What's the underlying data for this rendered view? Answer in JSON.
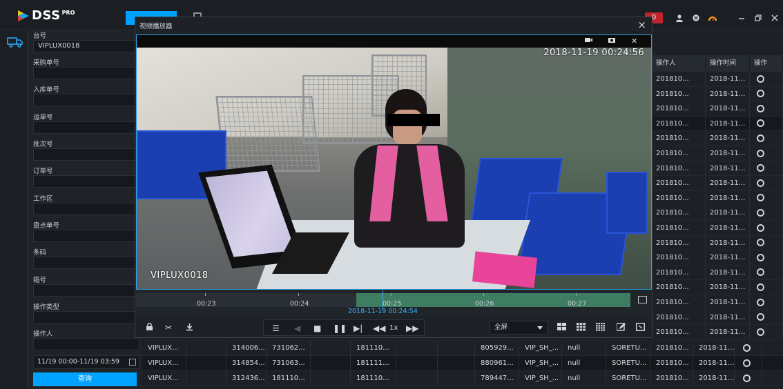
{
  "app": {
    "name": "DSS",
    "edition": "PRO"
  },
  "header": {
    "alarm_count": "0"
  },
  "filter": {
    "fields": [
      {
        "label": "台号",
        "value": "VIPLUX0018"
      },
      {
        "label": "采购单号",
        "value": ""
      },
      {
        "label": "入库单号",
        "value": ""
      },
      {
        "label": "运单号",
        "value": ""
      },
      {
        "label": "批次号",
        "value": ""
      },
      {
        "label": "订单号",
        "value": ""
      },
      {
        "label": "工作区",
        "value": ""
      },
      {
        "label": "盘点单号",
        "value": ""
      },
      {
        "label": "条码",
        "value": ""
      },
      {
        "label": "箱号",
        "value": ""
      },
      {
        "label": "操作类型",
        "value": ""
      },
      {
        "label": "操作人",
        "value": ""
      }
    ],
    "date_range": "11/19 00:00-11/19 03:59",
    "query_label": "查询"
  },
  "modal": {
    "title": "视频播放器",
    "video_timestamp": "2018-11-19 00:24:56",
    "camera_label": "VIPLUX0018"
  },
  "timeline": {
    "labels": [
      "00:23",
      "00:24",
      "00:25",
      "00:26",
      "00:27"
    ],
    "cursor_time": "2018-11-19 00:24:54"
  },
  "controls": {
    "speed": "1x",
    "layout_select": "全屏"
  },
  "right_table": {
    "headers": [
      "操作人",
      "操作时间",
      "操作"
    ],
    "rows": [
      [
        "201810...",
        "2018-11..."
      ],
      [
        "201810...",
        "2018-11..."
      ],
      [
        "201810...",
        "2018-11..."
      ],
      [
        "201810...",
        "2018-11..."
      ],
      [
        "201810...",
        "2018-11..."
      ],
      [
        "201810...",
        "2018-11..."
      ],
      [
        "201810...",
        "2018-11..."
      ],
      [
        "201810...",
        "2018-11..."
      ],
      [
        "201810...",
        "2018-11..."
      ],
      [
        "201810...",
        "2018-11..."
      ],
      [
        "201810...",
        "2018-11..."
      ],
      [
        "201810...",
        "2018-11..."
      ],
      [
        "201810...",
        "2018-11..."
      ],
      [
        "201810...",
        "2018-11..."
      ],
      [
        "201810...",
        "2018-11..."
      ],
      [
        "201810...",
        "2018-11..."
      ],
      [
        "201810...",
        "2018-11..."
      ],
      [
        "201810...",
        "2018-11..."
      ]
    ]
  },
  "bottom_table": {
    "rows": [
      [
        "VIPLUX...",
        "",
        "314006...",
        "731062...",
        "",
        "181110...",
        "",
        "",
        "805929...",
        "VIP_SH_...",
        "null",
        "SORETU...",
        "201810...",
        "2018-11..."
      ],
      [
        "VIPLUX...",
        "",
        "314854...",
        "731063...",
        "",
        "181111...",
        "",
        "",
        "880961...",
        "VIP_SH_...",
        "null",
        "SORETU...",
        "201810...",
        "2018-11..."
      ],
      [
        "VIPLUX...",
        "",
        "312436...",
        "181110...",
        "",
        "181110...",
        "",
        "",
        "789447...",
        "VIP_SH_...",
        "null",
        "SORETU...",
        "201810...",
        "2018-11..."
      ]
    ]
  },
  "colors": {
    "accent": "#00a2ff",
    "alarm": "#c0242b",
    "timeline_played": "#3f7d62",
    "cursor": "#3ab1ff"
  }
}
